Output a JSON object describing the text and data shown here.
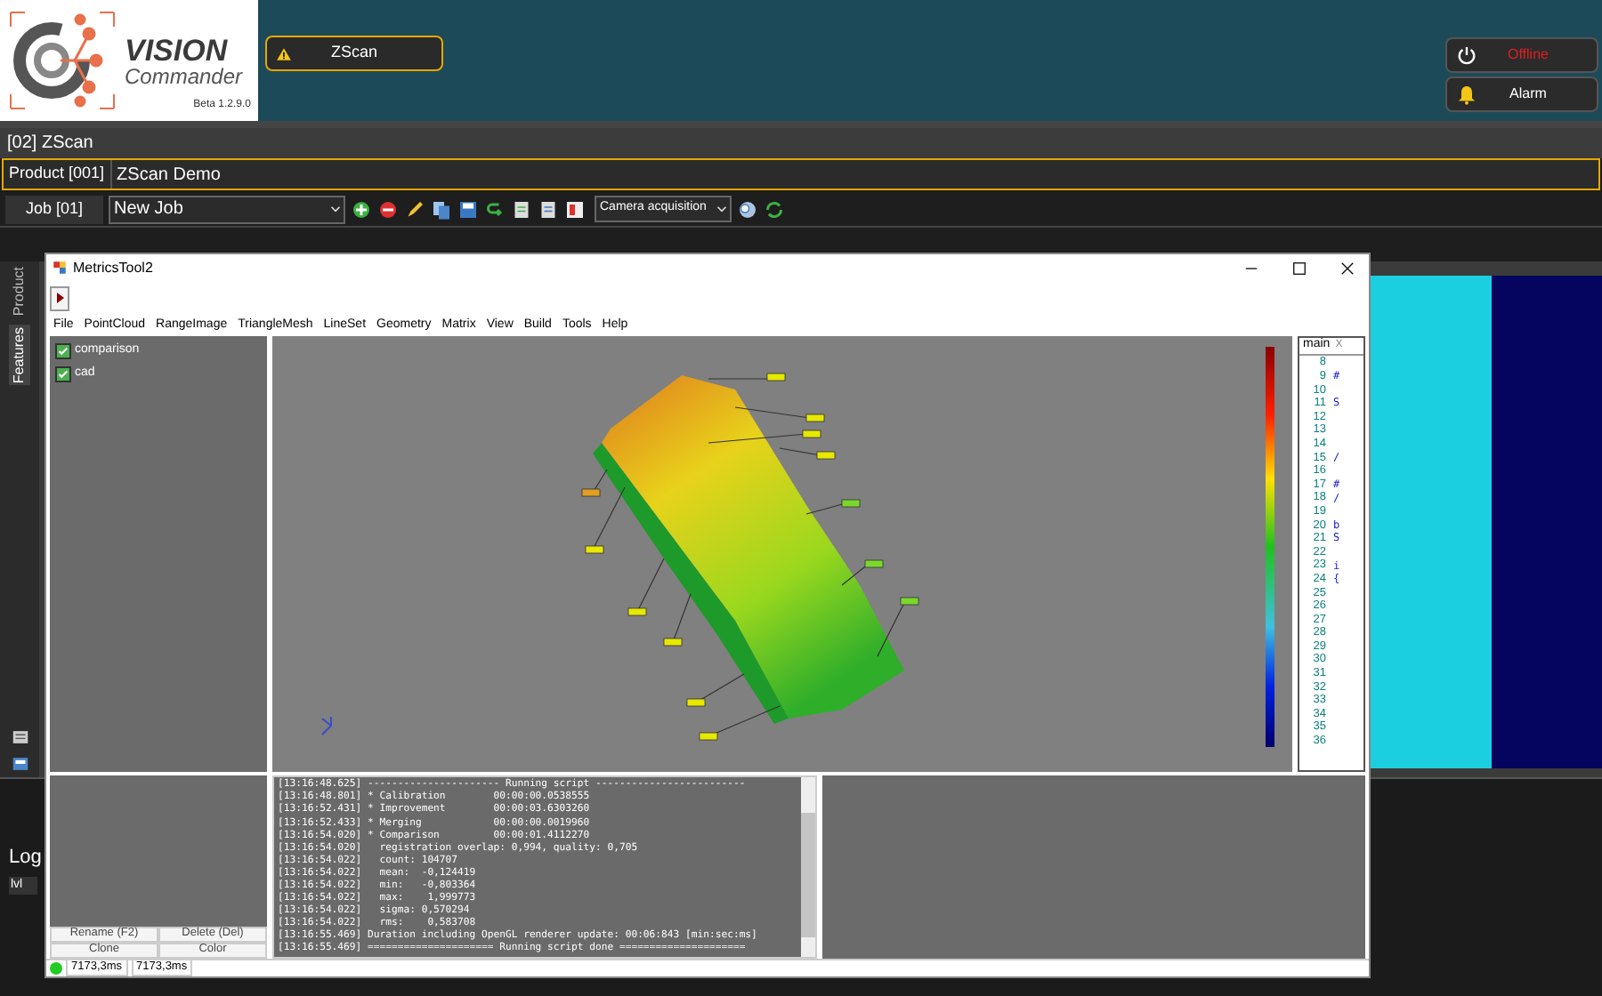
{
  "logo": {
    "title": "VISION",
    "subtitle": "Commander",
    "version": "Beta 1.2.9.0"
  },
  "station_tabs": [
    {
      "label": "ZScan",
      "warning": true,
      "selected": true
    }
  ],
  "status_buttons": [
    {
      "kind": "power",
      "label": "Offline"
    },
    {
      "kind": "alarm",
      "label": "Alarm"
    }
  ],
  "station_bar": {
    "label": "[02] ZScan"
  },
  "product": {
    "label": "Product [001]",
    "value": "ZScan Demo"
  },
  "job": {
    "label": "Job [01]",
    "value": "New Job",
    "acquisition": "Camera acquisition"
  },
  "side_tabs": [
    {
      "label": "Product",
      "selected": false
    },
    {
      "label": "Features",
      "selected": true
    }
  ],
  "log": {
    "title": "Log",
    "level_label": "lvl"
  },
  "tool_window": {
    "title": "MetricsTool2",
    "menu": [
      "File",
      "PointCloud",
      "RangeImage",
      "TriangleMesh",
      "LineSet",
      "Geometry",
      "Matrix",
      "View",
      "Build",
      "Tools",
      "Help"
    ],
    "tree": [
      {
        "label": "comparison",
        "checked": true
      },
      {
        "label": "cad",
        "checked": true
      }
    ],
    "tree_buttons": [
      "Rename (F2)",
      "Delete (Del)",
      "Clone",
      "Color"
    ],
    "editor": {
      "tab": "main",
      "close": "X",
      "lines": [
        {
          "number": "8"
        },
        {
          "number": "9",
          "code": "#"
        },
        {
          "number": "10"
        },
        {
          "number": "11",
          "code": "S"
        },
        {
          "number": "12"
        },
        {
          "number": "13"
        },
        {
          "number": "14"
        },
        {
          "number": "15",
          "code": "/"
        },
        {
          "number": "16"
        },
        {
          "number": "17",
          "code": "#"
        },
        {
          "number": "18",
          "code": "/"
        },
        {
          "number": "19"
        },
        {
          "number": "20",
          "code": "b"
        },
        {
          "number": "21",
          "code": "S"
        },
        {
          "number": "22"
        },
        {
          "number": "23",
          "code": "i"
        },
        {
          "number": "24",
          "code": "{"
        },
        {
          "number": "25"
        },
        {
          "number": "26"
        },
        {
          "number": "27"
        },
        {
          "number": "28"
        },
        {
          "number": "29"
        },
        {
          "number": "30"
        },
        {
          "number": "31"
        },
        {
          "number": "32"
        },
        {
          "number": "33"
        },
        {
          "number": "34"
        },
        {
          "number": "35"
        },
        {
          "number": "36"
        }
      ]
    },
    "console": [
      "[13:16:48.625] ---------------------- Running script -------------------------",
      "[13:16:48.801] * Calibration        00:00:00.0538555",
      "[13:16:52.431] * Improvement        00:00:03.6303260",
      "[13:16:52.433] * Merging            00:00:00.0019960",
      "[13:16:54.020] * Comparison         00:00:01.4112270",
      "[13:16:54.020]   registration overlap: 0,994, quality: 0,705",
      "[13:16:54.022]   count: 104707",
      "[13:16:54.022]   mean:  -0,124419",
      "[13:16:54.022]   min:   -0,803364",
      "[13:16:54.022]   max:    1,999773",
      "[13:16:54.022]   sigma: 0,570294",
      "[13:16:54.022]   rms:    0,583708",
      "[13:16:55.469] Duration including OpenGL renderer update: 00:06:843 [min:sec:ms]",
      "[13:16:55.469] ===================== Running script done ====================="
    ],
    "status_bar": {
      "connected": true,
      "timings": [
        "7173,3ms",
        "7173,3ms"
      ]
    }
  }
}
